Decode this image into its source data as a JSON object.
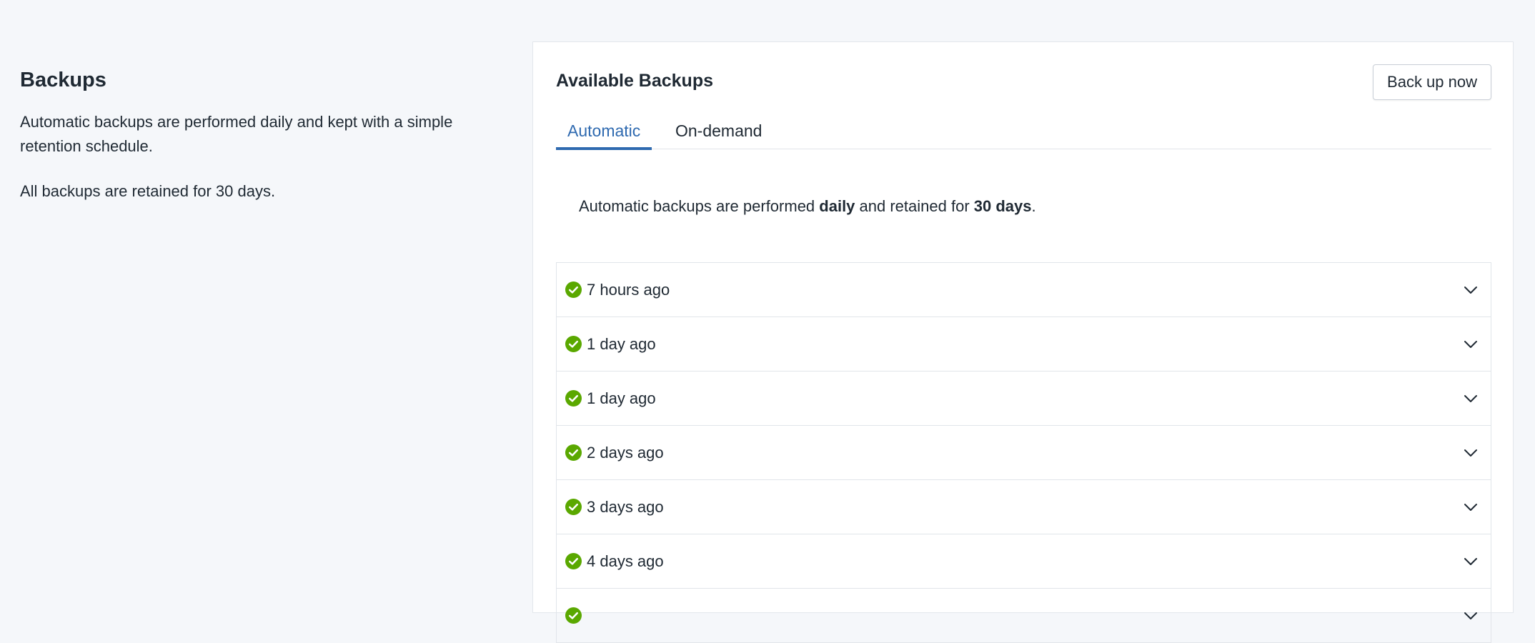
{
  "settings": {
    "title": "Backups",
    "description": "Automatic backups are performed daily and kept with a simple retention schedule.",
    "retention_note": "All backups are retained for 30 days."
  },
  "panel": {
    "title": "Available Backups",
    "backup_button_label": "Back up now",
    "tabs": [
      {
        "label": "Automatic",
        "active": true
      },
      {
        "label": "On-demand",
        "active": false
      }
    ],
    "info": {
      "prefix": "Automatic backups are performed ",
      "frequency": "daily",
      "middle": " and retained for ",
      "retention": "30 days",
      "suffix": "."
    },
    "backups": [
      {
        "label": "7 hours ago",
        "status": "success",
        "status_icon": "check-circle-icon"
      },
      {
        "label": "1 day ago",
        "status": "success",
        "status_icon": "check-circle-icon"
      },
      {
        "label": "1 day ago",
        "status": "success",
        "status_icon": "check-circle-icon"
      },
      {
        "label": "2 days ago",
        "status": "success",
        "status_icon": "check-circle-icon"
      },
      {
        "label": "3 days ago",
        "status": "success",
        "status_icon": "check-circle-icon"
      },
      {
        "label": "4 days ago",
        "status": "success",
        "status_icon": "check-circle-icon"
      },
      {
        "label": "",
        "status": "success",
        "status_icon": "check-circle-icon"
      }
    ]
  },
  "colors": {
    "accent": "#2f6ab0",
    "success": "#5aa800",
    "background": "#f5f7fa",
    "text": "#1f2933"
  }
}
